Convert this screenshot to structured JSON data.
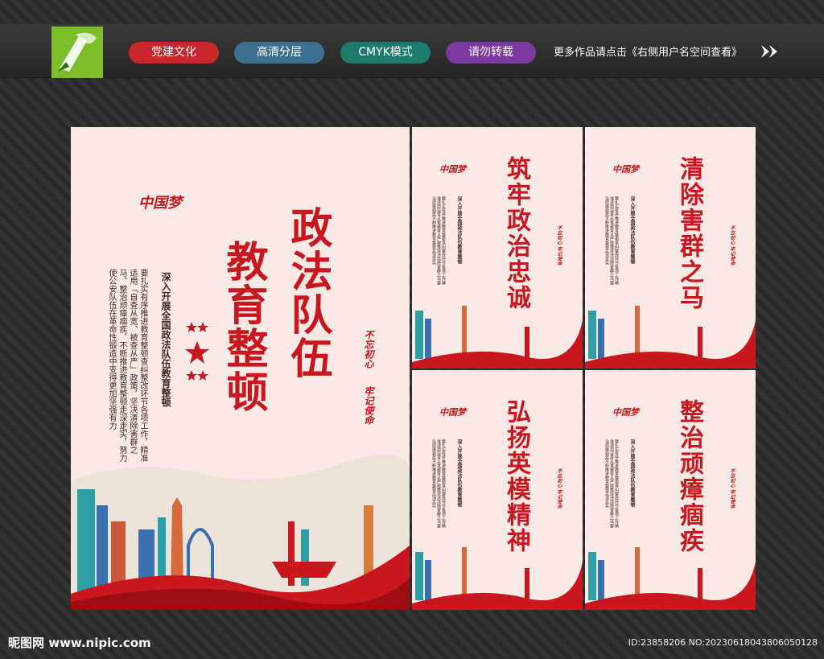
{
  "header": {
    "tags": [
      {
        "label": "党建文化",
        "color": "#c8272e"
      },
      {
        "label": "高清分层",
        "color": "#3f6f8f"
      },
      {
        "label": "CMYK模式",
        "color": "#1f7a6e"
      },
      {
        "label": "请勿转载",
        "color": "#7b3aa0"
      }
    ],
    "more_text": "更多作品请点击《右侧用户名空间查看》"
  },
  "main_poster": {
    "title_col1": "政法队伍",
    "title_col2": "教育整顿",
    "subtitle": "深入开展全国政法队伍教育整顿",
    "body": "要扎实有序推进教育整顿查纠整改环节各项工作，精准适用「自查从宽、被查从严」政策，坚决清除害群之马、整治顽瘴痼疾，不断推进教育整顿走深走实，努力使公安队伍在革命性锻造中变得更加坚强有力",
    "seal_1": "不忘初心",
    "seal_2": "牢记使命",
    "logo_text": "中国梦"
  },
  "small_posters": [
    {
      "title": "筑牢政治忠诚"
    },
    {
      "title": "清除害群之马"
    },
    {
      "title": "弘扬英模精神"
    },
    {
      "title": "整治顽瘴痼疾"
    }
  ],
  "small_common": {
    "subtitle": "深入开展全国政法队伍教育整顿",
    "body": "要扎实有序推进教育整顿查纠整改环节各项工作精准适用自查从宽被查从严政策坚决清除害群之马整治顽瘴痼疾不断推进教育整顿走深走实",
    "seal": "不忘初心 牢记使命",
    "logo_text": "中国梦"
  },
  "footer": {
    "site": "昵图网 www.nipic.com",
    "id": "ID:23858206 NO:20230618043806050128"
  },
  "colors": {
    "accent": "#c8171e",
    "poster_bg": "#fbe9e6"
  }
}
